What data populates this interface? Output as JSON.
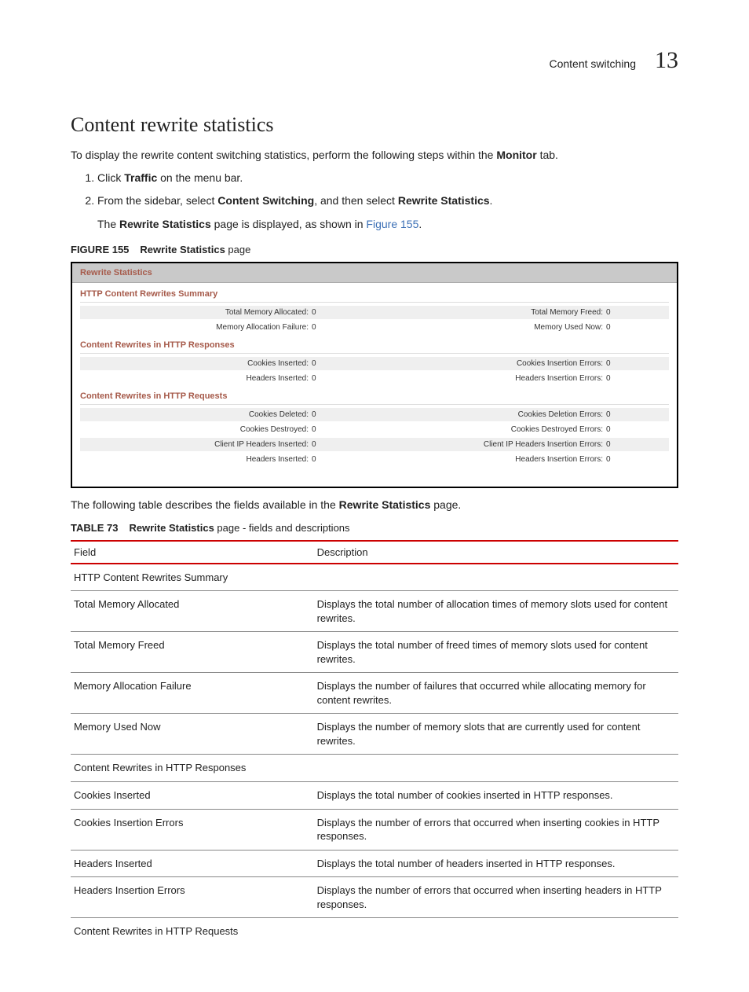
{
  "header": {
    "breadcrumb": "Content switching",
    "chapter": "13"
  },
  "title": "Content rewrite statistics",
  "intro": {
    "pre": "To display the rewrite content switching statistics, perform the following steps within the ",
    "bold": "Monitor",
    "post": " tab."
  },
  "steps": {
    "s1": {
      "pre": "Click ",
      "b1": "Traffic",
      "post": " on the menu bar."
    },
    "s2": {
      "pre": "From the sidebar, select ",
      "b1": "Content Switching",
      "mid": ", and then select ",
      "b2": "Rewrite Statistics",
      "post": ".",
      "sub_pre": "The ",
      "sub_b": "Rewrite Statistics",
      "sub_mid": " page is displayed, as shown in ",
      "sub_link": "Figure 155",
      "sub_post": "."
    }
  },
  "figcap": {
    "label": "FIGURE 155",
    "bold": "Rewrite Statistics",
    "suffix": " page"
  },
  "shot": {
    "title": "Rewrite Statistics",
    "g1": {
      "legend": "HTTP Content Rewrites Summary",
      "r1": {
        "l1": "Total Memory Allocated:",
        "v1": "0",
        "l2": "Total Memory Freed:",
        "v2": "0"
      },
      "r2": {
        "l1": "Memory Allocation Failure:",
        "v1": "0",
        "l2": "Memory Used Now:",
        "v2": "0"
      }
    },
    "g2": {
      "legend": "Content Rewrites in HTTP Responses",
      "r1": {
        "l1": "Cookies Inserted:",
        "v1": "0",
        "l2": "Cookies Insertion Errors:",
        "v2": "0"
      },
      "r2": {
        "l1": "Headers Inserted:",
        "v1": "0",
        "l2": "Headers Insertion Errors:",
        "v2": "0"
      }
    },
    "g3": {
      "legend": "Content Rewrites in HTTP Requests",
      "r1": {
        "l1": "Cookies Deleted:",
        "v1": "0",
        "l2": "Cookies Deletion Errors:",
        "v2": "0"
      },
      "r2": {
        "l1": "Cookies Destroyed:",
        "v1": "0",
        "l2": "Cookies Destroyed Errors:",
        "v2": "0"
      },
      "r3": {
        "l1": "Client IP Headers Inserted:",
        "v1": "0",
        "l2": "Client IP Headers Insertion Errors:",
        "v2": "0"
      },
      "r4": {
        "l1": "Headers Inserted:",
        "v1": "0",
        "l2": "Headers Insertion Errors:",
        "v2": "0"
      }
    }
  },
  "after_fig": {
    "pre": "The following table describes the fields available in the ",
    "b": "Rewrite Statistics",
    "post": " page."
  },
  "tabcap": {
    "label": "TABLE 73",
    "bold": "Rewrite Statistics",
    "suffix": " page - fields and descriptions"
  },
  "table": {
    "h1": "Field",
    "h2": "Description",
    "rows": [
      {
        "f": "HTTP Content Rewrites Summary",
        "d": ""
      },
      {
        "f": "Total Memory Allocated",
        "d": "Displays the total number of allocation times of memory slots used for content rewrites."
      },
      {
        "f": "Total Memory Freed",
        "d": "Displays the total number of freed times of memory slots used for content rewrites."
      },
      {
        "f": "Memory Allocation Failure",
        "d": "Displays the number of failures that occurred while allocating memory for content rewrites."
      },
      {
        "f": "Memory Used Now",
        "d": "Displays the number of memory slots that are currently used for content rewrites."
      },
      {
        "f": "Content Rewrites in HTTP Responses",
        "d": ""
      },
      {
        "f": "Cookies Inserted",
        "d": "Displays the total number of cookies inserted in HTTP responses."
      },
      {
        "f": "Cookies Insertion Errors",
        "d": "Displays the number of errors that occurred when inserting cookies in HTTP responses."
      },
      {
        "f": "Headers Inserted",
        "d": "Displays the total number of headers inserted in HTTP responses."
      },
      {
        "f": "Headers Insertion Errors",
        "d": "Displays the number of errors that occurred when inserting headers in HTTP responses."
      },
      {
        "f": "Content Rewrites in HTTP Requests",
        "d": ""
      }
    ]
  }
}
